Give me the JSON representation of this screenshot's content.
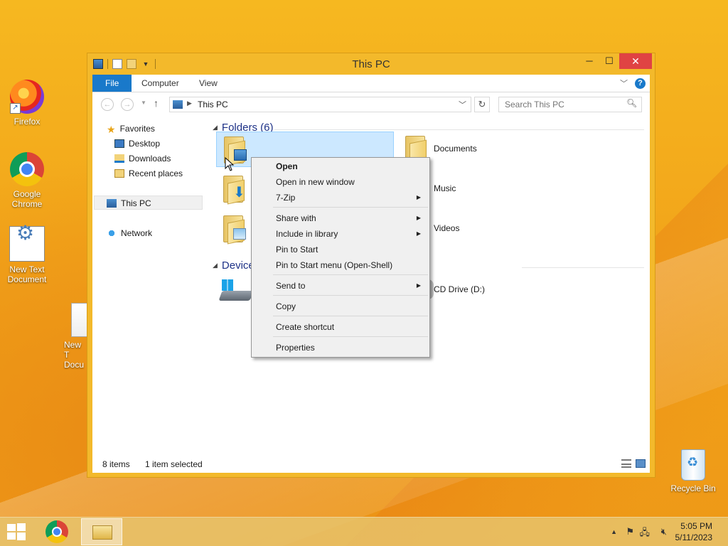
{
  "desktop": {
    "icons": [
      {
        "label": "Firefox"
      },
      {
        "label": "Google Chrome"
      },
      {
        "label": "New Text Document"
      },
      {
        "label": "New T Docu"
      },
      {
        "label": "Recycle Bin"
      }
    ]
  },
  "window": {
    "title": "This PC",
    "ribbon_tabs": [
      "File",
      "Computer",
      "View"
    ],
    "address": {
      "crumb": "This PC"
    },
    "search": {
      "placeholder": "Search This PC"
    },
    "nav": {
      "favorites": "Favorites",
      "desktop": "Desktop",
      "downloads": "Downloads",
      "recent": "Recent places",
      "this_pc": "This PC",
      "network": "Network"
    },
    "groups": {
      "folders": "Folders (6)",
      "devices": "Device"
    },
    "tiles": {
      "documents": "Documents",
      "music": "Music",
      "videos": "Videos",
      "cd_drive": "CD Drive (D:)"
    },
    "status": {
      "items": "8 items",
      "selected": "1 item selected"
    }
  },
  "context_menu": {
    "items": [
      {
        "label": "Open"
      },
      {
        "label": "Open in new window"
      },
      {
        "label": "7-Zip"
      },
      {
        "label": "Share with"
      },
      {
        "label": "Include in library"
      },
      {
        "label": "Pin to Start"
      },
      {
        "label": "Pin to Start menu (Open-Shell)"
      },
      {
        "label": "Send to"
      },
      {
        "label": "Copy"
      },
      {
        "label": "Create shortcut"
      },
      {
        "label": "Properties"
      }
    ]
  },
  "taskbar": {
    "time": "5:05 PM",
    "date": "5/11/2023"
  },
  "colors": {
    "accent": "#1979ca",
    "close": "#e04343",
    "window_frame": "#f3b92b",
    "selection": "#cce8ff"
  }
}
